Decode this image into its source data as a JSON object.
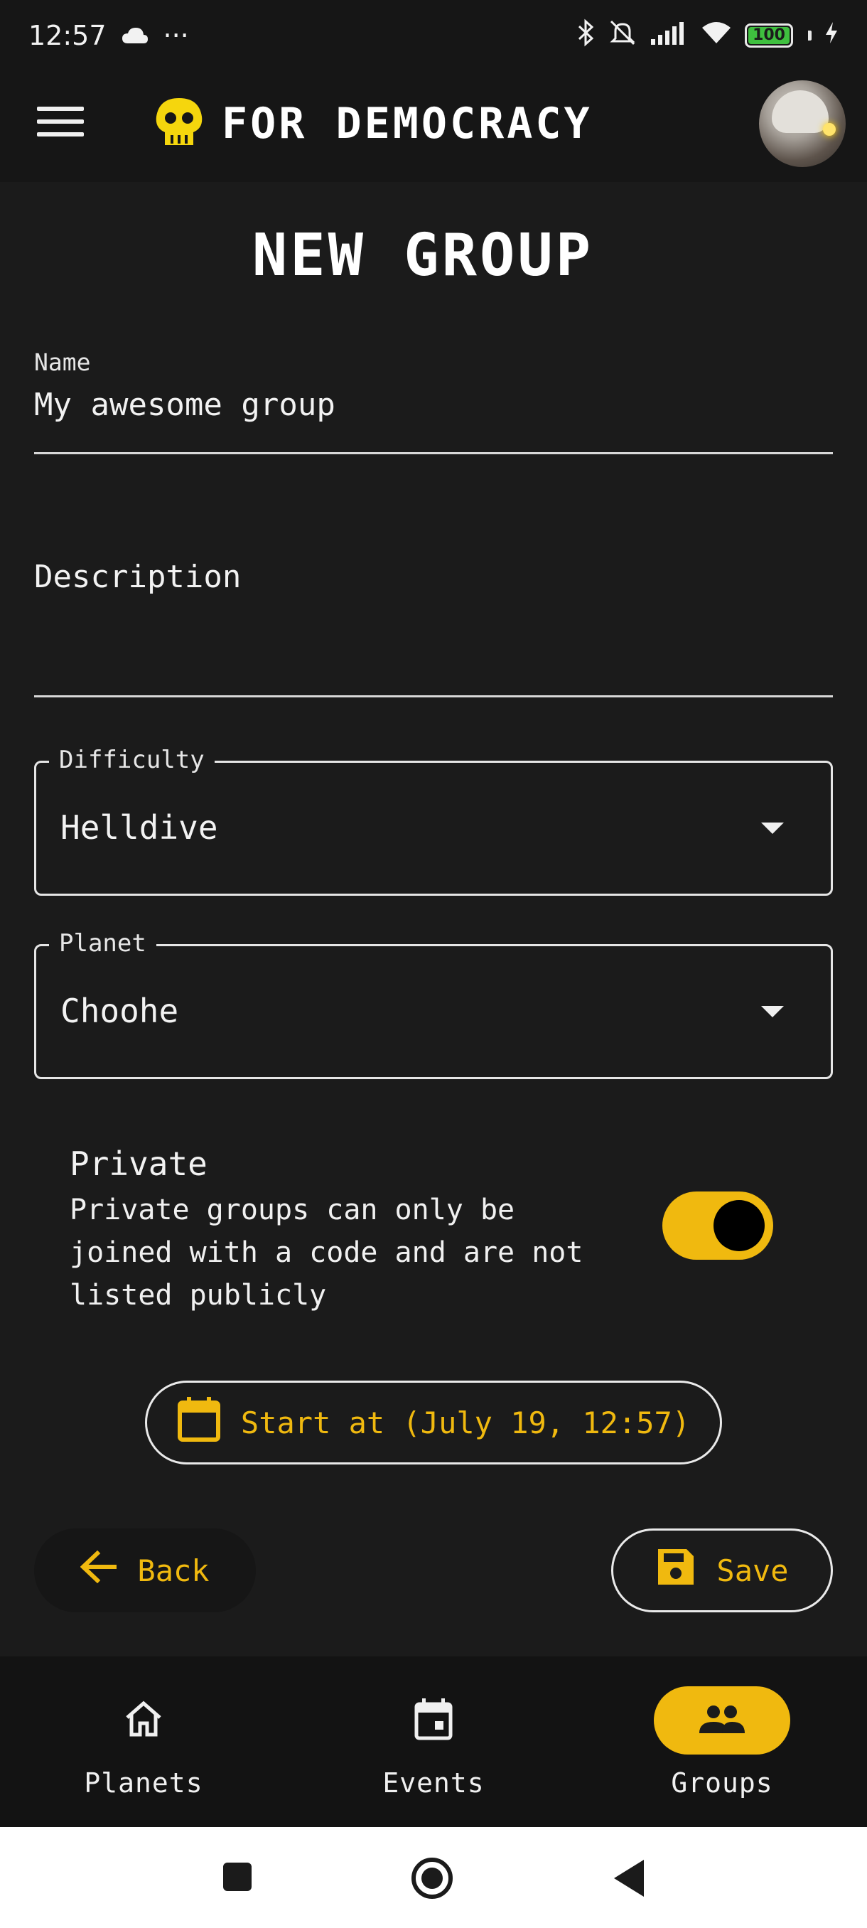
{
  "status_bar": {
    "time": "12:57",
    "more": "···",
    "battery": "100"
  },
  "app_bar": {
    "title": "FOR DEMOCRACY"
  },
  "page": {
    "title": "NEW GROUP"
  },
  "form": {
    "name_label": "Name",
    "name_value": "My awesome group",
    "description_placeholder": "Description",
    "difficulty_label": "Difficulty",
    "difficulty_value": "Helldive",
    "planet_label": "Planet",
    "planet_value": "Choohe",
    "private_title": "Private",
    "private_description": "Private groups can only be joined with a code and are not listed publicly",
    "private_enabled": true,
    "start_label": "Start at (July 19, 12:57)"
  },
  "actions": {
    "back_label": "Back",
    "save_label": "Save"
  },
  "bottom_nav": {
    "items": [
      {
        "label": "Planets",
        "icon": "home-icon",
        "active": false
      },
      {
        "label": "Events",
        "icon": "calendar-icon",
        "active": false
      },
      {
        "label": "Groups",
        "icon": "people-icon",
        "active": true
      }
    ]
  },
  "colors": {
    "accent": "#f0b90f",
    "background": "#1b1b1b"
  }
}
